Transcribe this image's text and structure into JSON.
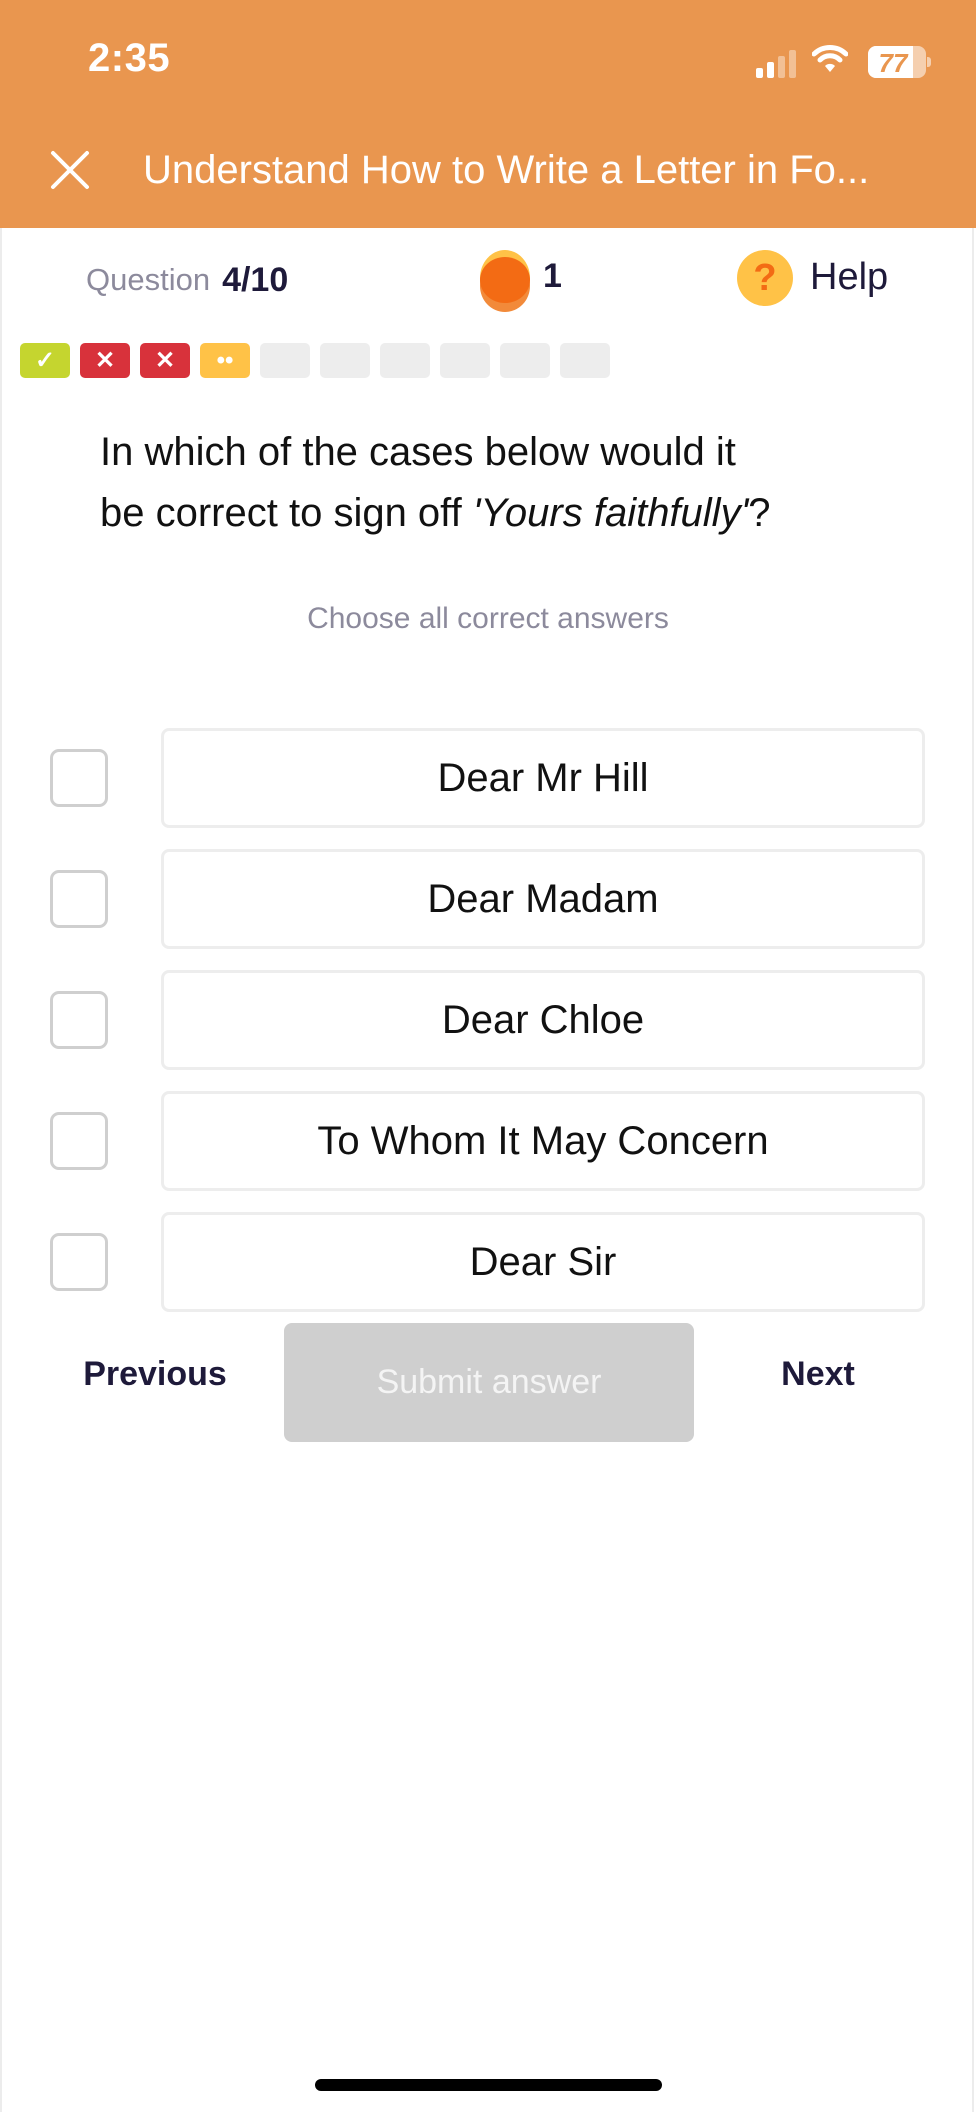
{
  "status_bar": {
    "time": "2:35",
    "battery": "77",
    "battery_level": 0.77,
    "signal_bars_active": 2,
    "signal_bars_total": 4
  },
  "header": {
    "title": "Understand How to Write a Letter in Fo...",
    "close_icon": "close-icon"
  },
  "quiz_info": {
    "question_label": "Question",
    "question_count": "4/10",
    "coins": "1",
    "help_label": "Help",
    "help_glyph": "?"
  },
  "progress": [
    {
      "state": "correct",
      "glyph": "✓",
      "color": "#C5D52F"
    },
    {
      "state": "wrong",
      "glyph": "✕",
      "color": "#D8323B"
    },
    {
      "state": "wrong",
      "glyph": "✕",
      "color": "#D8323B"
    },
    {
      "state": "current",
      "glyph": "••",
      "color": "#FFC247"
    },
    {
      "state": "pending",
      "glyph": "",
      "color": "#EDEDED"
    },
    {
      "state": "pending",
      "glyph": "",
      "color": "#EDEDED"
    },
    {
      "state": "pending",
      "glyph": "",
      "color": "#EDEDED"
    },
    {
      "state": "pending",
      "glyph": "",
      "color": "#EDEDED"
    },
    {
      "state": "pending",
      "glyph": "",
      "color": "#EDEDED"
    },
    {
      "state": "pending",
      "glyph": "",
      "color": "#EDEDED"
    }
  ],
  "question": {
    "line1": "In which of the cases below would it",
    "line2_prefix": "be correct to sign off ",
    "line2_emphasis": "'Yours faithfully'",
    "line2_suffix": "?",
    "instruction": "Choose all correct answers"
  },
  "options": [
    {
      "label": "Dear Mr Hill",
      "checked": false
    },
    {
      "label": "Dear Madam",
      "checked": false
    },
    {
      "label": "Dear Chloe",
      "checked": false
    },
    {
      "label": "To Whom It May Concern",
      "checked": false
    },
    {
      "label": "Dear Sir",
      "checked": false
    }
  ],
  "actions": {
    "previous": "Previous",
    "submit": "Submit answer",
    "next": "Next"
  },
  "colors": {
    "header": "#E9964F",
    "text_dark": "#1E1A3A",
    "muted": "#8C8A9C",
    "coin": "#F36B14",
    "help_bg": "#FFC247",
    "submit_disabled": "#CFCFCF"
  }
}
